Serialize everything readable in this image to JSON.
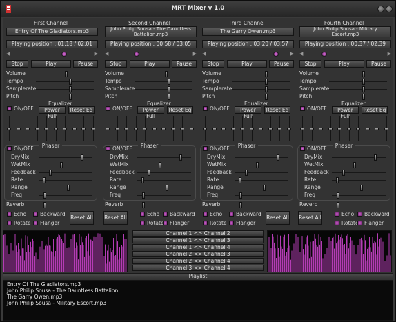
{
  "window": {
    "title": "MRT Mixer v 1.0"
  },
  "channels": [
    {
      "title": "First Channel",
      "track": "Entry Of The Gladiators.mp3",
      "position": "Playing position : 01:18 / 02:01",
      "progress": 0.64,
      "sliders": {
        "volume": 0.53,
        "tempo": 0.6,
        "samplerate": 0.6,
        "pitch": 0.6
      },
      "eq": [
        0.55,
        0.55,
        0.55,
        0.55,
        0.55,
        0.55,
        0.55,
        0.55,
        0.55,
        0.55
      ],
      "phaser": {
        "drymix": 0.82,
        "wetmix": 0.42,
        "feedback": 0.2,
        "rate": 0.08,
        "range": 0.55,
        "freq": 0.1
      },
      "reverb": 0.25
    },
    {
      "title": "Second Channel",
      "track": "John Philip Sousa - The Dauntless Battalion.mp3",
      "position": "Playing position : 00:58 / 03:05",
      "progress": 0.31,
      "sliders": {
        "volume": 0.55,
        "tempo": 0.6,
        "samplerate": 0.6,
        "pitch": 0.6
      },
      "eq": [
        0.55,
        0.55,
        0.55,
        0.55,
        0.55,
        0.55,
        0.55,
        0.55,
        0.55,
        0.55
      ],
      "phaser": {
        "drymix": 0.82,
        "wetmix": 0.42,
        "feedback": 0.2,
        "rate": 0.08,
        "range": 0.55,
        "freq": 0.1
      },
      "reverb": 0.25
    },
    {
      "title": "Third Channel",
      "track": "The Garry Owen.mp3",
      "position": "Playing position : 03:20 / 03:57",
      "progress": 0.84,
      "sliders": {
        "volume": 0.6,
        "tempo": 0.6,
        "samplerate": 0.6,
        "pitch": 0.6
      },
      "eq": [
        0.55,
        0.55,
        0.55,
        0.55,
        0.55,
        0.55,
        0.55,
        0.55,
        0.55,
        0.55
      ],
      "phaser": {
        "drymix": 0.82,
        "wetmix": 0.42,
        "feedback": 0.2,
        "rate": 0.08,
        "range": 0.55,
        "freq": 0.1
      },
      "reverb": 0.25
    },
    {
      "title": "Fourth Channel",
      "track": "John Philip Sousa - Military Escort.mp3",
      "position": "Playing position : 00:37 / 02:39",
      "progress": 0.23,
      "sliders": {
        "volume": 0.6,
        "tempo": 0.6,
        "samplerate": 0.6,
        "pitch": 0.6
      },
      "eq": [
        0.55,
        0.55,
        0.55,
        0.55,
        0.55,
        0.55,
        0.55,
        0.55,
        0.55,
        0.55
      ],
      "phaser": {
        "drymix": 0.82,
        "wetmix": 0.42,
        "feedback": 0.2,
        "rate": 0.08,
        "range": 0.55,
        "freq": 0.1
      },
      "reverb": 0.25
    }
  ],
  "labels": {
    "stop": "Stop",
    "play": "Play",
    "pause": "Pause",
    "volume": "Volume",
    "tempo": "Tempo",
    "samplerate": "Samplerate",
    "pitch": "Pitch",
    "onoff": "ON/OFF",
    "equalizer": "Equalizer",
    "power_full": "Power Full",
    "reset_eq": "Reset Eq",
    "phaser": "Phaser",
    "drymix": "DryMix",
    "wetmix": "WetMix",
    "feedback": "Feedback",
    "rate": "Rate",
    "range": "Range",
    "freq": "Freq",
    "reverb": "Reverb",
    "echo": "Echo",
    "backward": "Backward",
    "rotate": "Rotate",
    "flanger": "Flanger",
    "reset_all": "Reset All"
  },
  "mixes": [
    "Channel 1 <> Channel 2",
    "Channel 1 <> Channel 3",
    "Channel 1 <> Channel 4",
    "Channel 2 <> Channel 3",
    "Channel 2 <> Channel 4",
    "Channel 3 <> Channel 4"
  ],
  "playlist": {
    "title": "Playlist",
    "items": [
      "Entry Of The Gladiators.mp3",
      "John Philip Sousa -  The Dauntless Battalion",
      "The Garry Owen.mp3",
      "John Philip Sousa - Military Escort.mp3"
    ]
  },
  "colors": {
    "accent": "#b43cb4",
    "background": "#333333",
    "visualizer_bg": "#070707"
  }
}
